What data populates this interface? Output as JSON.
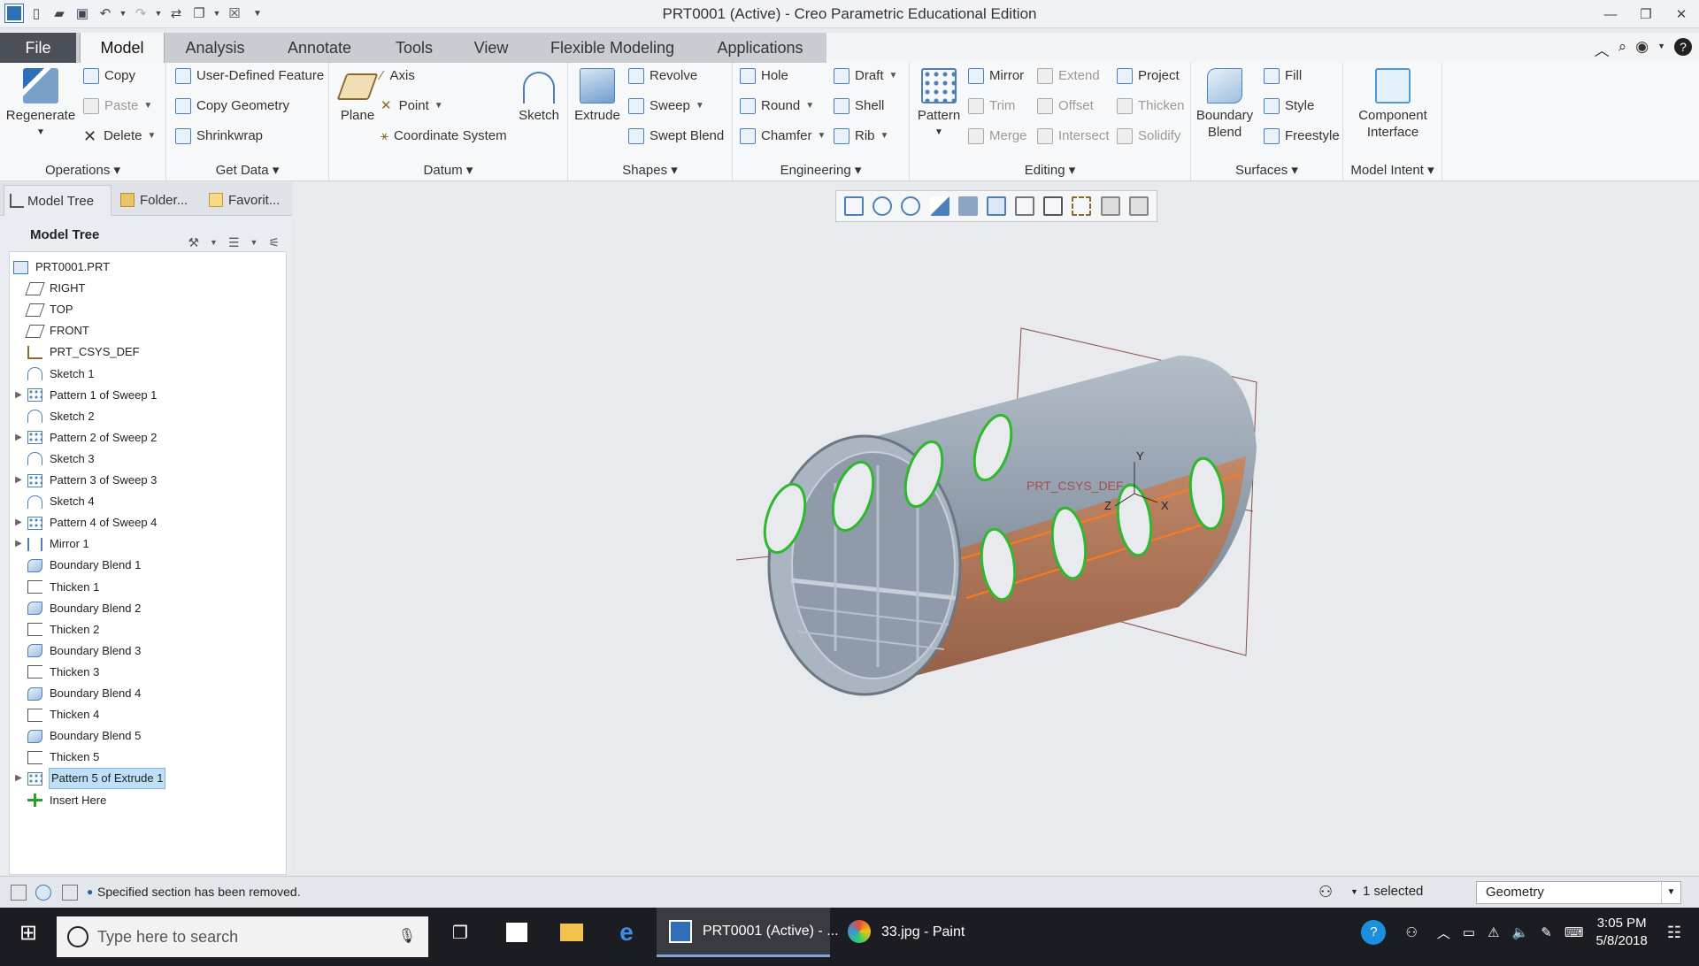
{
  "window": {
    "title": "PRT0001 (Active) - Creo Parametric Educational Edition"
  },
  "tabs": {
    "file": "File",
    "items": [
      "Model",
      "Analysis",
      "Annotate",
      "Tools",
      "View",
      "Flexible Modeling",
      "Applications"
    ],
    "active": "Model"
  },
  "ribbon": {
    "operations": {
      "label": "Operations",
      "regenerate": "Regenerate",
      "copy": "Copy",
      "paste": "Paste",
      "delete": "Delete"
    },
    "get_data": {
      "label": "Get Data",
      "udf": "User-Defined Feature",
      "copy_geometry": "Copy Geometry",
      "shrinkwrap": "Shrinkwrap"
    },
    "datum": {
      "label": "Datum",
      "plane": "Plane",
      "axis": "Axis",
      "point": "Point",
      "csys": "Coordinate System",
      "sketch": "Sketch"
    },
    "shapes": {
      "label": "Shapes",
      "extrude": "Extrude",
      "revolve": "Revolve",
      "sweep": "Sweep",
      "swept_blend": "Swept Blend"
    },
    "engineering": {
      "label": "Engineering",
      "hole": "Hole",
      "round": "Round",
      "chamfer": "Chamfer",
      "draft": "Draft",
      "shell": "Shell",
      "rib": "Rib"
    },
    "editing": {
      "label": "Editing",
      "pattern": "Pattern",
      "mirror": "Mirror",
      "trim": "Trim",
      "merge": "Merge",
      "extend": "Extend",
      "offset": "Offset",
      "intersect": "Intersect",
      "project": "Project",
      "thicken": "Thicken",
      "solidify": "Solidify"
    },
    "surfaces": {
      "label": "Surfaces",
      "boundary_blend_1": "Boundary",
      "boundary_blend_2": "Blend",
      "fill": "Fill",
      "style": "Style",
      "freestyle": "Freestyle"
    },
    "model_intent": {
      "label": "Model Intent",
      "component_1": "Component",
      "component_2": "Interface"
    }
  },
  "panel": {
    "tabs": [
      "Model Tree",
      "Folder...",
      "Favorit..."
    ],
    "header": "Model Tree",
    "tree": [
      {
        "label": "PRT0001.PRT",
        "icon": "part-icon",
        "expandable": false,
        "indent": 0
      },
      {
        "label": "RIGHT",
        "icon": "datum-plane-icon",
        "expandable": false,
        "indent": 1
      },
      {
        "label": "TOP",
        "icon": "datum-plane-icon",
        "expandable": false,
        "indent": 1
      },
      {
        "label": "FRONT",
        "icon": "datum-plane-icon",
        "expandable": false,
        "indent": 1
      },
      {
        "label": "PRT_CSYS_DEF",
        "icon": "csys-icon",
        "expandable": false,
        "indent": 1
      },
      {
        "label": "Sketch 1",
        "icon": "sketch-icon",
        "expandable": false,
        "indent": 1
      },
      {
        "label": "Pattern 1 of Sweep 1",
        "icon": "pattern-icon",
        "expandable": true,
        "indent": 1
      },
      {
        "label": "Sketch 2",
        "icon": "sketch-icon",
        "expandable": false,
        "indent": 1
      },
      {
        "label": "Pattern 2 of Sweep 2",
        "icon": "pattern-icon",
        "expandable": true,
        "indent": 1
      },
      {
        "label": "Sketch 3",
        "icon": "sketch-icon",
        "expandable": false,
        "indent": 1
      },
      {
        "label": "Pattern 3 of Sweep 3",
        "icon": "pattern-icon",
        "expandable": true,
        "indent": 1
      },
      {
        "label": "Sketch 4",
        "icon": "sketch-icon",
        "expandable": false,
        "indent": 1
      },
      {
        "label": "Pattern 4 of Sweep 4",
        "icon": "pattern-icon",
        "expandable": true,
        "indent": 1
      },
      {
        "label": "Mirror 1",
        "icon": "mirror-icon",
        "expandable": true,
        "indent": 1
      },
      {
        "label": "Boundary Blend 1",
        "icon": "boundary-blend-icon",
        "expandable": false,
        "indent": 1
      },
      {
        "label": "Thicken 1",
        "icon": "thicken-icon",
        "expandable": false,
        "indent": 1
      },
      {
        "label": "Boundary Blend 2",
        "icon": "boundary-blend-icon",
        "expandable": false,
        "indent": 1
      },
      {
        "label": "Thicken 2",
        "icon": "thicken-icon",
        "expandable": false,
        "indent": 1
      },
      {
        "label": "Boundary Blend 3",
        "icon": "boundary-blend-icon",
        "expandable": false,
        "indent": 1
      },
      {
        "label": "Thicken 3",
        "icon": "thicken-icon",
        "expandable": false,
        "indent": 1
      },
      {
        "label": "Boundary Blend 4",
        "icon": "boundary-blend-icon",
        "expandable": false,
        "indent": 1
      },
      {
        "label": "Thicken 4",
        "icon": "thicken-icon",
        "expandable": false,
        "indent": 1
      },
      {
        "label": "Boundary Blend 5",
        "icon": "boundary-blend-icon",
        "expandable": false,
        "indent": 1
      },
      {
        "label": "Thicken 5",
        "icon": "thicken-icon",
        "expandable": false,
        "indent": 1
      },
      {
        "label": "Pattern 5 of Extrude 1",
        "icon": "pattern-icon",
        "expandable": true,
        "indent": 1,
        "selected": true
      },
      {
        "label": "Insert Here",
        "icon": "insert-here-icon",
        "expandable": false,
        "indent": 1
      }
    ]
  },
  "viewport": {
    "csys_label": "PRT_CSYS_DEF",
    "axis_x": "X",
    "axis_y": "Y",
    "axis_z": "Z"
  },
  "status": {
    "message": "Specified section has been removed.",
    "selected": "1 selected",
    "filter": "Geometry"
  },
  "taskbar": {
    "search_placeholder": "Type here to search",
    "app1": "PRT0001 (Active) - ...",
    "app2": "33.jpg - Paint",
    "time": "3:05 PM",
    "date": "5/8/2018"
  },
  "colors": {
    "accent": "#4b4f57",
    "selection": "#bde0f7",
    "model_body": "#9aa6b4",
    "highlight_edges": "#ff7a1a",
    "window_edges": "#2db82d"
  }
}
